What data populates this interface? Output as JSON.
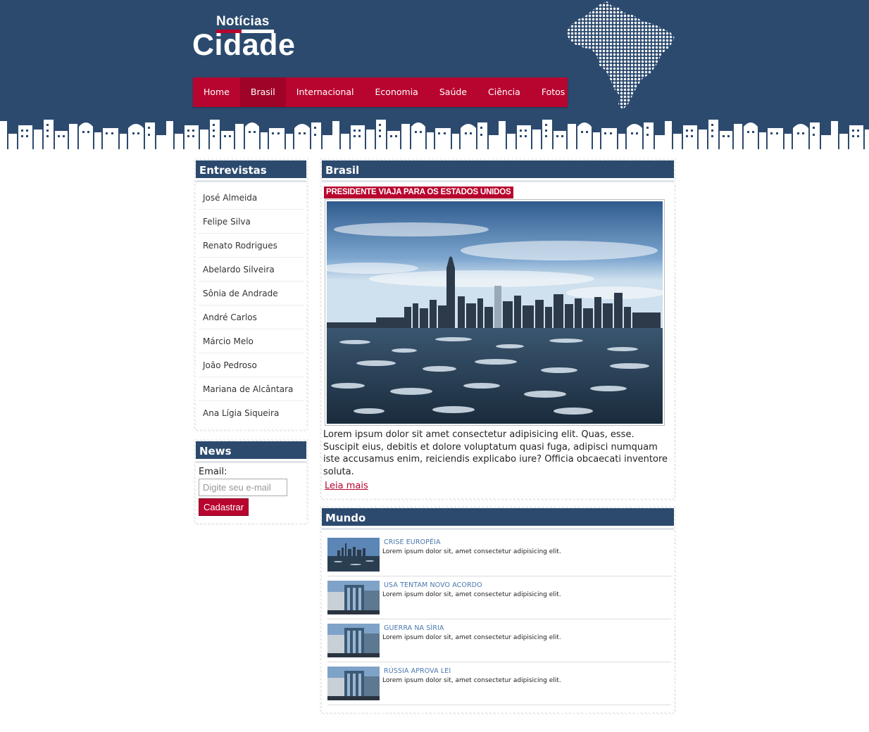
{
  "brand": {
    "small": "Notícias",
    "big": "Cidade"
  },
  "nav": {
    "items": [
      "Home",
      "Brasil",
      "Internacional",
      "Economia",
      "Saúde",
      "Ciência",
      "Fotos"
    ],
    "active": "Brasil"
  },
  "sidebar": {
    "interviews_title": "Entrevistas",
    "interviews": [
      "José Almeida",
      "Felipe Silva",
      "Renato Rodrigues",
      "Abelardo Silveira",
      "Sônia de Andrade",
      "André Carlos",
      "Márcio Melo",
      "João Pedroso",
      "Mariana de Alcântara",
      "Ana Lígia Siqueira"
    ],
    "news_title": "News",
    "email_label": "Email:",
    "email_placeholder": "Digite seu e-mail",
    "subscribe_label": "Cadastrar"
  },
  "main": {
    "section_title": "Brasil",
    "headline": "PRESIDENTE VIAJA PARA OS ESTADOS UNIDOS",
    "body": "Lorem ipsum dolor sit amet consectetur adipisicing elit. Quas, esse. Suscipit eius, debitis et dolore voluptatum quasi fuga, adipisci numquam iste accusamus enim, reiciendis explicabo iure? Officia obcaecati inventore soluta.",
    "read_more": "Leia mais"
  },
  "world": {
    "section_title": "Mundo",
    "items": [
      {
        "title": "CRISE EUROPÉIA",
        "desc": "Lorem ipsum dolor sit, amet consectetur adipisicing elit."
      },
      {
        "title": "USA TENTAM NOVO ACORDO",
        "desc": "Lorem ipsum dolor sit, amet consectetur adipisicing elit."
      },
      {
        "title": "GUERRA NA SÍRIA",
        "desc": "Lorem ipsum dolor sit, amet consectetur adipisicing elit."
      },
      {
        "title": "RÚSSIA APROVA LEI",
        "desc": "Lorem ipsum dolor sit, amet consectetur adipisicing elit."
      }
    ]
  },
  "colors": {
    "header_blue": "#2c4a6e",
    "accent_red": "#b8052f",
    "link_blue": "#4a78b0"
  }
}
